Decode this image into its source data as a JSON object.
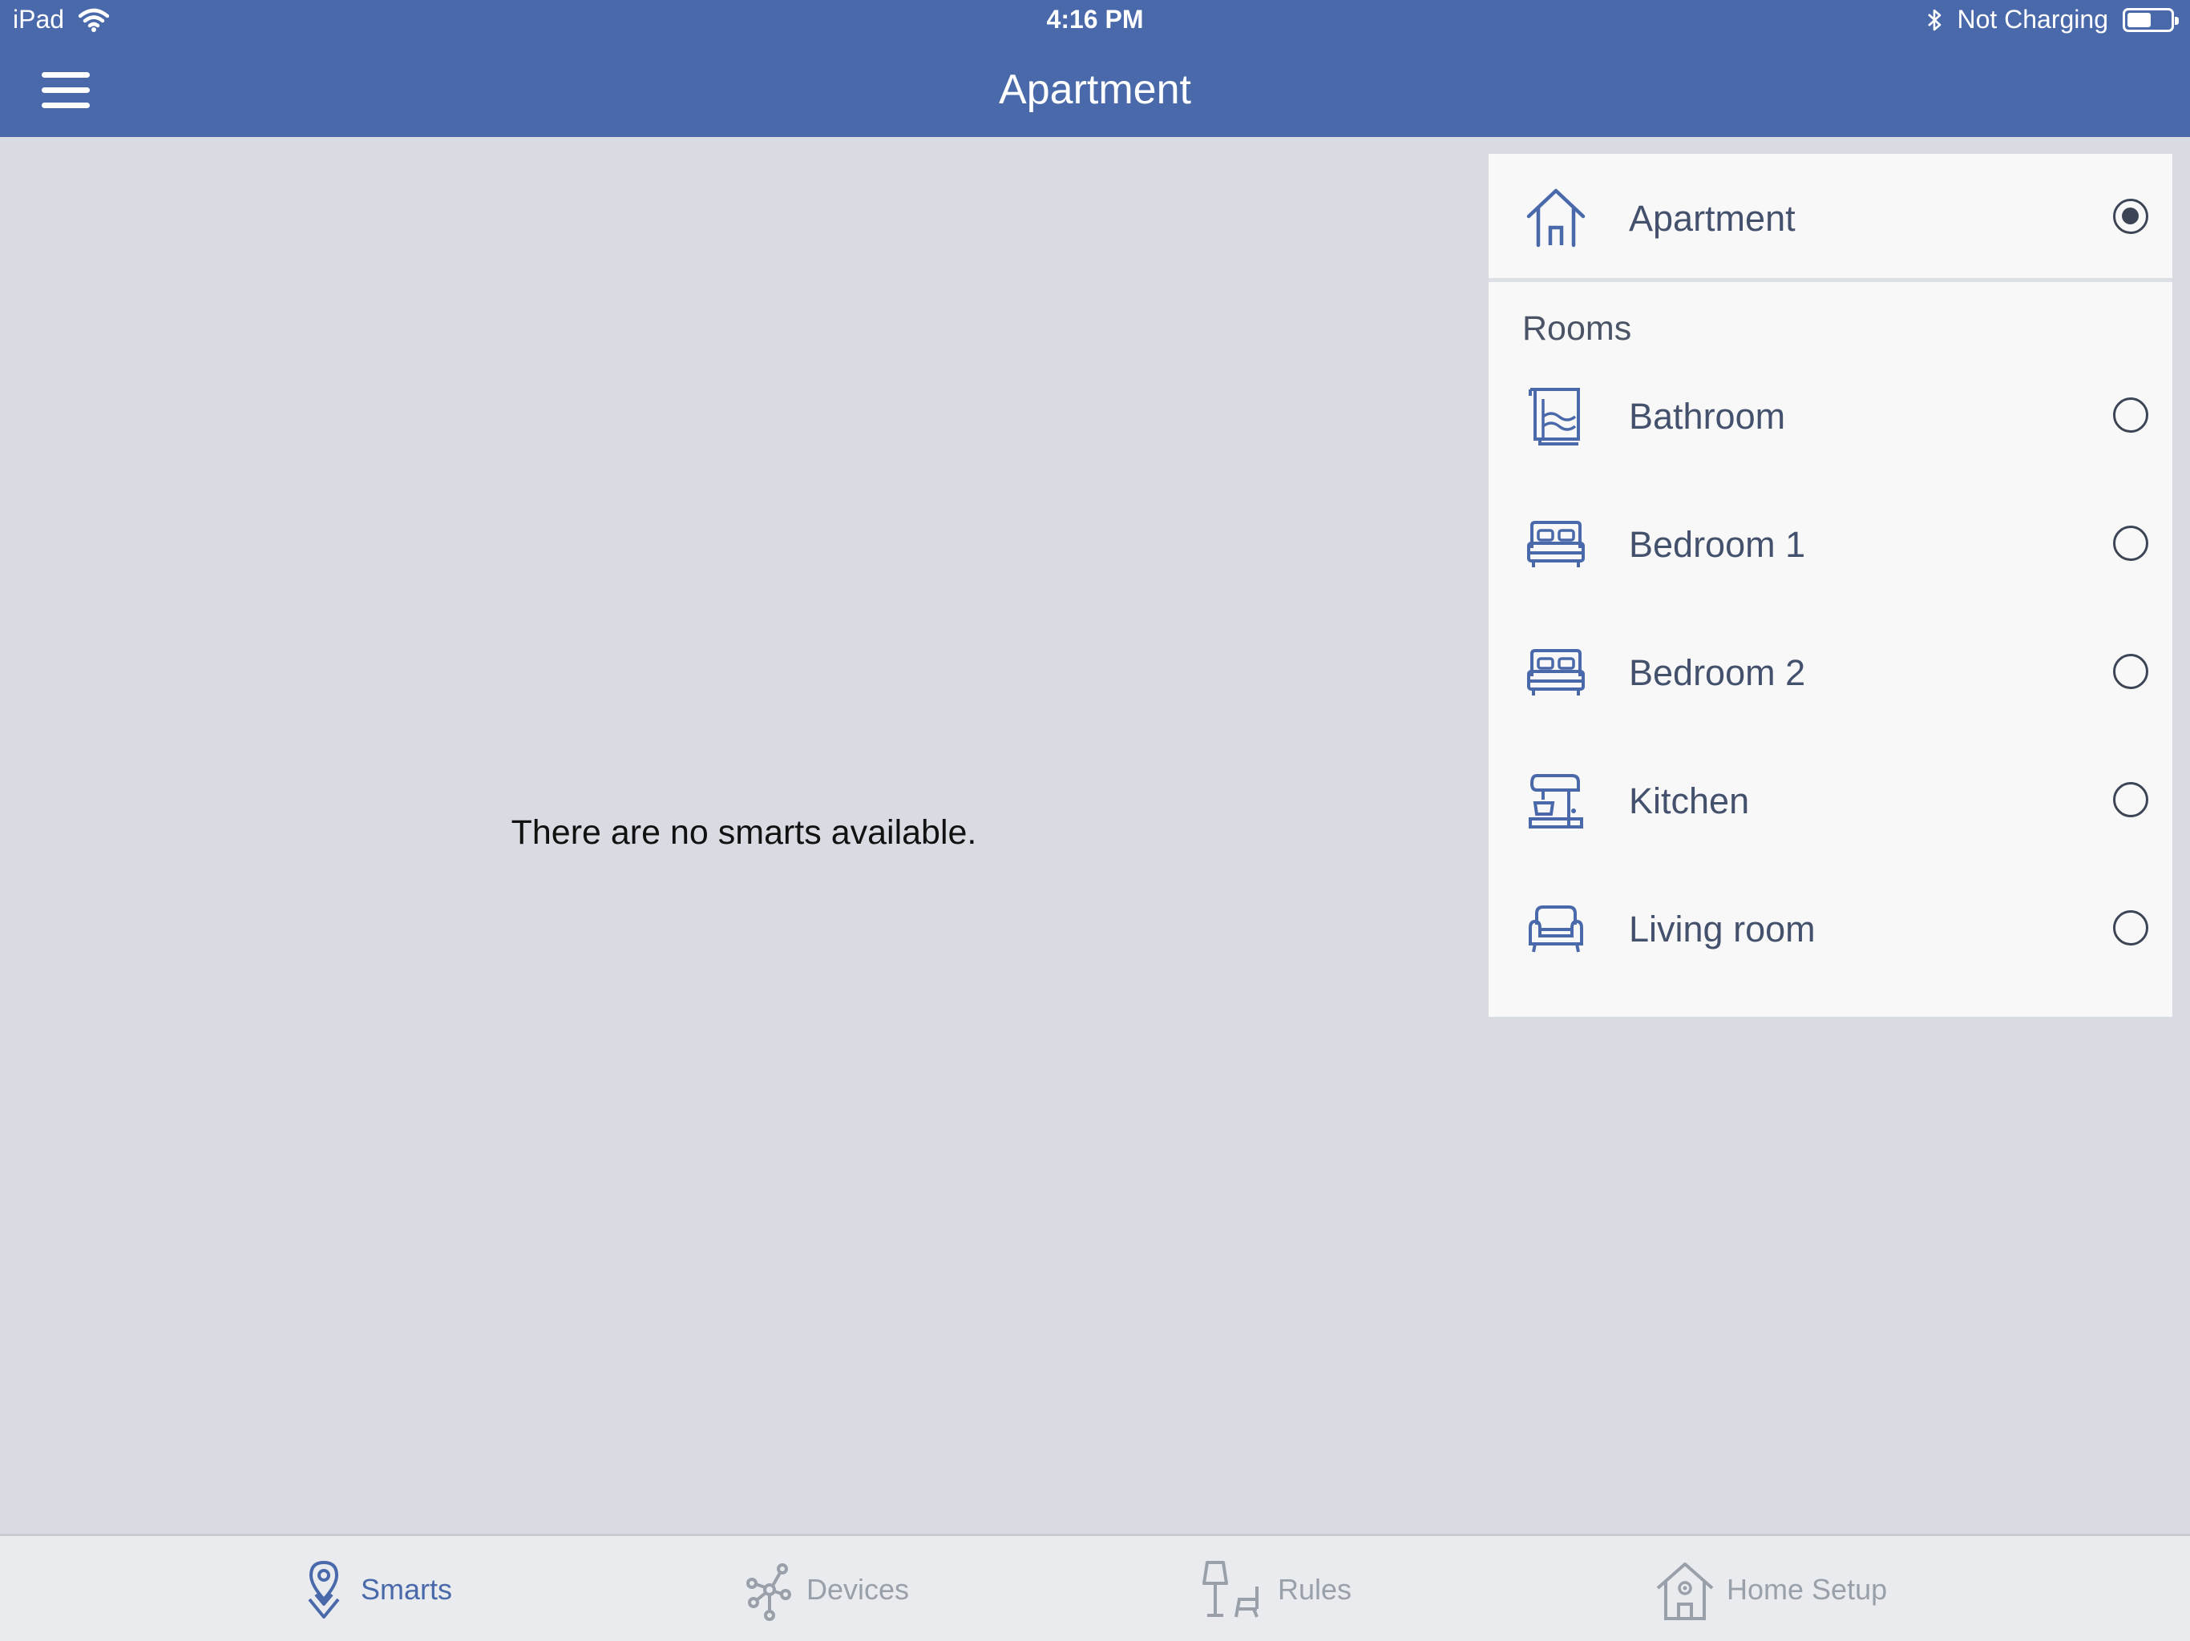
{
  "status_bar": {
    "device": "iPad",
    "time": "4:16 PM",
    "charging": "Not Charging",
    "battery_level": 0.55
  },
  "header": {
    "title": "Apartment"
  },
  "main": {
    "empty_message": "There are no smarts available."
  },
  "panel": {
    "home": {
      "label": "Apartment",
      "selected": true,
      "icon": "house-icon"
    },
    "rooms_heading": "Rooms",
    "rooms": [
      {
        "label": "Bathroom",
        "icon": "bath-icon",
        "selected": false
      },
      {
        "label": "Bedroom 1",
        "icon": "bed-icon",
        "selected": false
      },
      {
        "label": "Bedroom 2",
        "icon": "bed-icon",
        "selected": false
      },
      {
        "label": "Kitchen",
        "icon": "mixer-icon",
        "selected": false
      },
      {
        "label": "Living room",
        "icon": "sofa-icon",
        "selected": false
      }
    ]
  },
  "tabs": [
    {
      "label": "Smarts",
      "icon": "location-pin-icon",
      "active": true
    },
    {
      "label": "Devices",
      "icon": "network-icon",
      "active": false
    },
    {
      "label": "Rules",
      "icon": "lamp-chair-icon",
      "active": false
    },
    {
      "label": "Home Setup",
      "icon": "house-gear-icon",
      "active": false
    }
  ],
  "colors": {
    "header_bg": "#4a69aa",
    "content_bg": "#d8dce2",
    "panel_bg": "#f8f8f8",
    "icon_blue": "#4a69aa",
    "tab_inactive": "#9aa0aa"
  }
}
